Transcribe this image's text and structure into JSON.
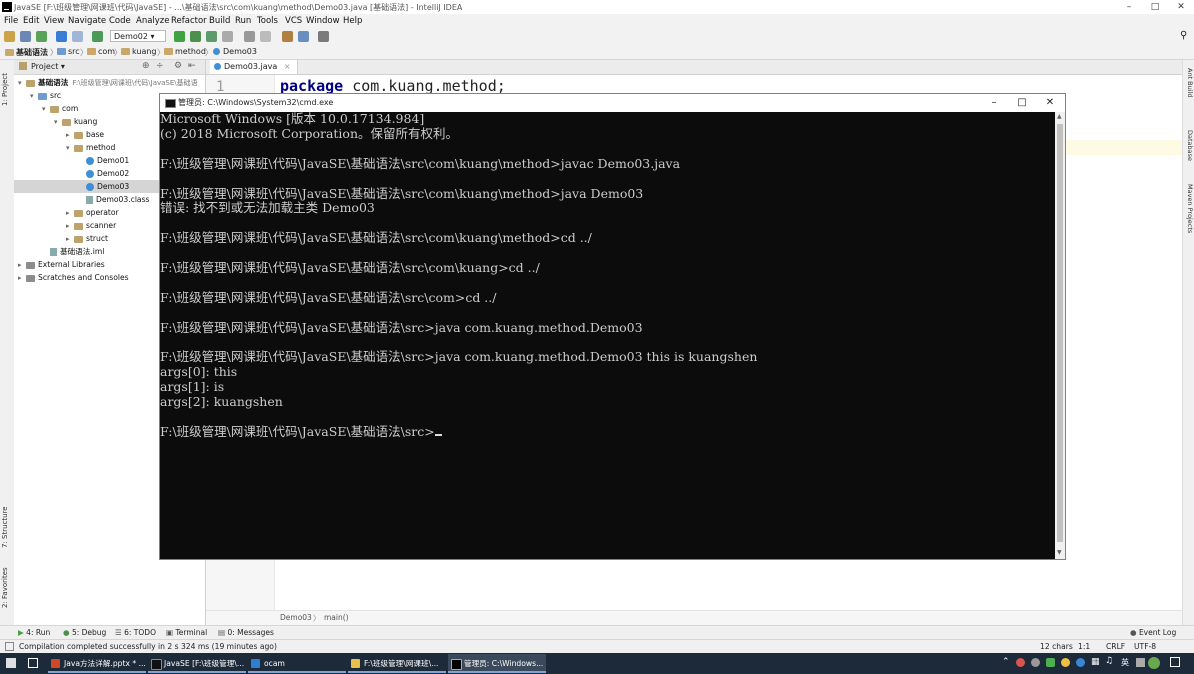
{
  "ide": {
    "window_title": "JavaSE [F:\\班级管理\\网课班\\代码\\JavaSE] - ...\\基础语法\\src\\com\\kuang\\method\\Demo03.java [基础语法] - IntelliJ IDEA",
    "menu": [
      "File",
      "Edit",
      "View",
      "Navigate",
      "Code",
      "Analyze",
      "Refactor",
      "Build",
      "Run",
      "Tools",
      "VCS",
      "Window",
      "Help"
    ],
    "run_config": "Demo02",
    "breadcrumb": [
      "基础语法",
      "src",
      "com",
      "kuang",
      "method",
      "Demo03"
    ],
    "left_strip": {
      "project": "1: Project",
      "structure": "7: Structure",
      "favorites": "2: Favorites"
    },
    "project_panel": {
      "header": "Project",
      "tree": [
        {
          "label": "基础语法",
          "hint": "F:\\班级管理\\网课班\\代码\\JavaSE\\基础语",
          "indent": 0,
          "arrow": "▾",
          "kind": "module"
        },
        {
          "label": "src",
          "indent": 1,
          "arrow": "▾",
          "kind": "srcfolder"
        },
        {
          "label": "com",
          "indent": 2,
          "arrow": "▾",
          "kind": "folder"
        },
        {
          "label": "kuang",
          "indent": 3,
          "arrow": "▾",
          "kind": "folder"
        },
        {
          "label": "base",
          "indent": 4,
          "arrow": "▸",
          "kind": "folder"
        },
        {
          "label": "method",
          "indent": 4,
          "arrow": "▾",
          "kind": "folder"
        },
        {
          "label": "Demo01",
          "indent": 5,
          "arrow": "",
          "kind": "class"
        },
        {
          "label": "Demo02",
          "indent": 5,
          "arrow": "",
          "kind": "class"
        },
        {
          "label": "Demo03",
          "indent": 5,
          "arrow": "",
          "kind": "class",
          "selected": true
        },
        {
          "label": "Demo03.class",
          "indent": 5,
          "arrow": "",
          "kind": "file"
        },
        {
          "label": "operator",
          "indent": 4,
          "arrow": "▸",
          "kind": "folder"
        },
        {
          "label": "scanner",
          "indent": 4,
          "arrow": "▸",
          "kind": "folder"
        },
        {
          "label": "struct",
          "indent": 4,
          "arrow": "▸",
          "kind": "folder"
        },
        {
          "label": "基础语法.iml",
          "indent": 2,
          "arrow": "",
          "kind": "file"
        },
        {
          "label": "External Libraries",
          "indent": 0,
          "arrow": "▸",
          "kind": "lib"
        },
        {
          "label": "Scratches and Consoles",
          "indent": 0,
          "arrow": "▸",
          "kind": "lib"
        }
      ]
    },
    "editor": {
      "tab": "Demo03.java",
      "line_number": "1",
      "code_keyword": "package",
      "code_rest": " com.kuang.method;",
      "breadcrumb": [
        "Demo03",
        "main()"
      ]
    },
    "right_strip": [
      "Ant Build",
      "Database",
      "Maven Projects"
    ],
    "bottom_tools": [
      "4: Run",
      "5: Debug",
      "6: TODO",
      "Terminal",
      "0: Messages"
    ],
    "event_log": "Event Log",
    "status_message": "Compilation completed successfully in 2 s 324 ms (19 minutes ago)",
    "status_right": {
      "chars": "12 chars",
      "position": "1:1",
      "line_sep": "CRLF",
      "encoding": "UTF-8"
    }
  },
  "cmd": {
    "title": "管理员: C:\\Windows\\System32\\cmd.exe",
    "lines": [
      "Microsoft Windows [版本 10.0.17134.984]",
      "(c) 2018 Microsoft Corporation。保留所有权利。",
      "",
      "F:\\班级管理\\网课班\\代码\\JavaSE\\基础语法\\src\\com\\kuang\\method>javac Demo03.java",
      "",
      "F:\\班级管理\\网课班\\代码\\JavaSE\\基础语法\\src\\com\\kuang\\method>java Demo03",
      "错误: 找不到或无法加载主类 Demo03",
      "",
      "F:\\班级管理\\网课班\\代码\\JavaSE\\基础语法\\src\\com\\kuang\\method>cd ../",
      "",
      "F:\\班级管理\\网课班\\代码\\JavaSE\\基础语法\\src\\com\\kuang>cd ../",
      "",
      "F:\\班级管理\\网课班\\代码\\JavaSE\\基础语法\\src\\com>cd ../",
      "",
      "F:\\班级管理\\网课班\\代码\\JavaSE\\基础语法\\src>java com.kuang.method.Demo03",
      "",
      "F:\\班级管理\\网课班\\代码\\JavaSE\\基础语法\\src>java com.kuang.method.Demo03 this is kuangshen",
      "args[0]: this",
      "args[1]: is",
      "args[2]: kuangshen",
      "",
      "F:\\班级管理\\网课班\\代码\\JavaSE\\基础语法\\src>"
    ]
  },
  "taskbar": {
    "items": [
      "Java方法详解.pptx * ...",
      "JavaSE [F:\\班级管理\\...",
      "ocam",
      "F:\\班级管理\\网课班\\...",
      "管理员: C:\\Windows..."
    ],
    "tray_lang": "英"
  },
  "colors": {
    "keyword": "#000080",
    "console_bg": "#0c0c0c",
    "console_text": "#cccccc",
    "taskbar_bg": "#1c2a3a",
    "cmd_border": "#5c86c4"
  }
}
